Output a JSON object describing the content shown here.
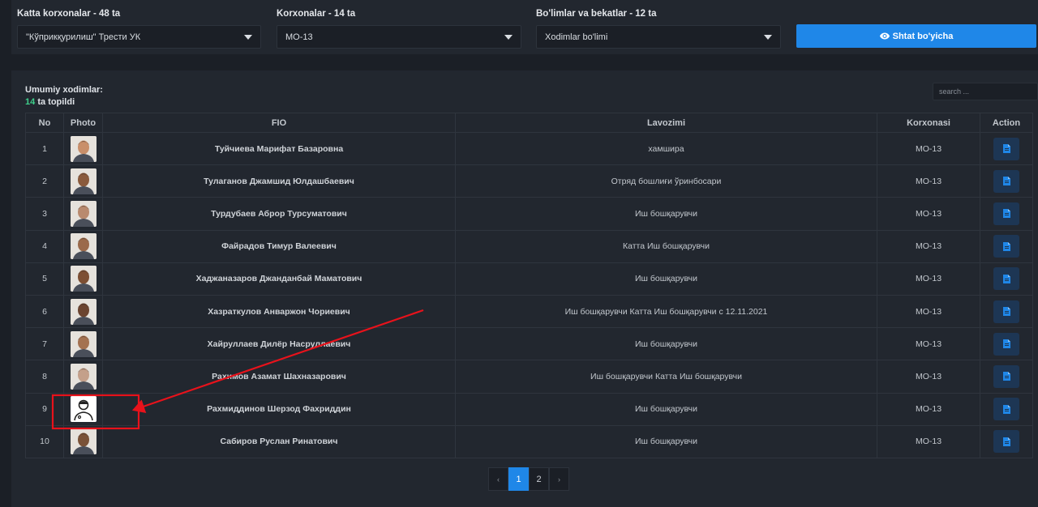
{
  "filters": {
    "katta": {
      "label": "Katta korxonalar - 48 ta",
      "value": "\"Кўприкқурилиш\" Трести УК"
    },
    "korxona": {
      "label": "Korxonalar - 14 ta",
      "value": "МО-13"
    },
    "bolim": {
      "label": "Bo'limlar va bekatlar - 12 ta",
      "value": "Xodimlar bo'limi"
    },
    "shtat_button": "Shtat bo'yicha"
  },
  "summary": {
    "title": "Umumiy xodimlar:",
    "count": "14",
    "found_text": "ta topildi"
  },
  "search": {
    "placeholder": "search ..."
  },
  "table": {
    "headers": {
      "no": "No",
      "photo": "Photo",
      "fio": "FIO",
      "lavozimi": "Lavozimi",
      "korxonasi": "Korxonasi",
      "action": "Action"
    },
    "rows": [
      {
        "no": "1",
        "fio": "Туйчиева Марифат Базаровна",
        "lavozimi": "хамшира",
        "korxonasi": "МО-13",
        "photo": "photo"
      },
      {
        "no": "2",
        "fio": "Тулаганов Джамшид Юлдашбаевич",
        "lavozimi": "Отряд бошлиғи ўринбосари",
        "korxonasi": "МО-13",
        "photo": "photo"
      },
      {
        "no": "3",
        "fio": "Турдубаев Аброр Турсуматович",
        "lavozimi": "Иш бошқарувчи",
        "korxonasi": "МО-13",
        "photo": "photo"
      },
      {
        "no": "4",
        "fio": "Файрадов Тимур Валеевич",
        "lavozimi": "Катта Иш бошқарувчи",
        "korxonasi": "МО-13",
        "photo": "photo"
      },
      {
        "no": "5",
        "fio": "Хаджаназаров Джанданбай Маматович",
        "lavozimi": "Иш бошқарувчи",
        "korxonasi": "МО-13",
        "photo": "photo"
      },
      {
        "no": "6",
        "fio": "Хазраткулов Анваржон Чориевич",
        "lavozimi": "Иш бошқарувчи Катта Иш бошқарувчи с 12.11.2021",
        "korxonasi": "МО-13",
        "photo": "photo"
      },
      {
        "no": "7",
        "fio": "Хайруллаев Дилёр Насруллаевич",
        "lavozimi": "Иш бошқарувчи",
        "korxonasi": "МО-13",
        "photo": "photo"
      },
      {
        "no": "8",
        "fio": "Рахимов Азамат Шахназарович",
        "lavozimi": "Иш бошқарувчи Катта Иш бошқарувчи",
        "korxonasi": "МО-13",
        "photo": "photo"
      },
      {
        "no": "9",
        "fio": "Рахмиддинов Шерзод Фахриддин",
        "lavozimi": "Иш бошқарувчи",
        "korxonasi": "МО-13",
        "photo": "placeholder"
      },
      {
        "no": "10",
        "fio": "Сабиров Руслан Ринатович",
        "lavozimi": "Иш бошқарувчи",
        "korxonasi": "МО-13",
        "photo": "photo"
      }
    ]
  },
  "pagination": {
    "prev": "‹",
    "pages": [
      "1",
      "2"
    ],
    "active": "1",
    "next": "›"
  },
  "annotation": {
    "color": "#e8121b",
    "target_row": "9"
  },
  "colors": {
    "accent": "#1f87e8",
    "count_green": "#3fd08c",
    "background": "#1b1f26",
    "panel": "#22272f"
  }
}
